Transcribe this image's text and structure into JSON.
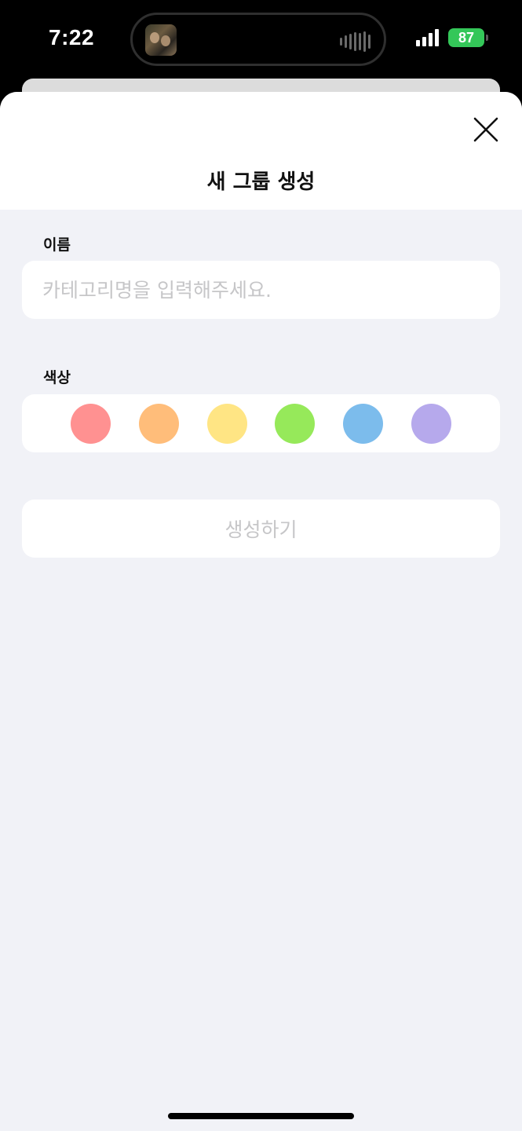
{
  "status_bar": {
    "time": "7:22",
    "battery": "87"
  },
  "sheet": {
    "title": "새 그룹 생성"
  },
  "name_field": {
    "label": "이름",
    "placeholder": "카테고리명을 입력해주세요.",
    "value": ""
  },
  "color_field": {
    "label": "색상",
    "swatches": [
      {
        "name": "red",
        "color": "#ff9191"
      },
      {
        "name": "orange",
        "color": "#ffbd7a"
      },
      {
        "name": "yellow",
        "color": "#ffe584"
      },
      {
        "name": "green",
        "color": "#96e95a"
      },
      {
        "name": "blue",
        "color": "#7cbcec"
      },
      {
        "name": "purple",
        "color": "#b6a9ec"
      }
    ]
  },
  "create_button": {
    "label": "생성하기"
  },
  "icons": {
    "close": "close-icon",
    "signal": "cellular-signal-icon",
    "battery": "battery-icon",
    "now_playing": "now-playing-artwork",
    "waveform": "audio-waveform-icon"
  }
}
